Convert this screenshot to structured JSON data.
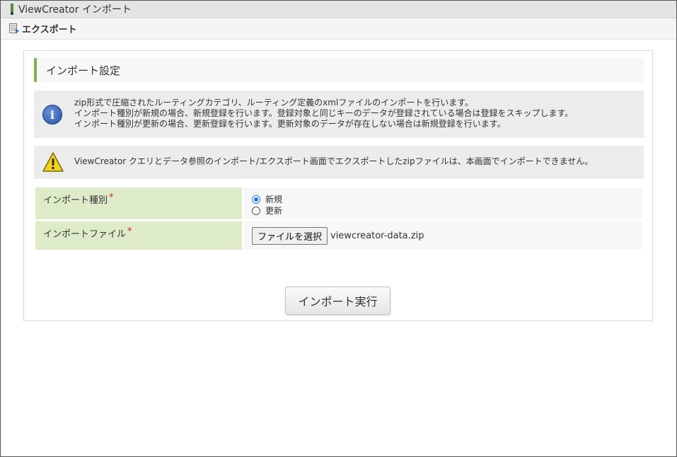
{
  "window": {
    "title": "ViewCreator インポート"
  },
  "toolbar": {
    "export_label": "エクスポート",
    "export_icon": "export-icon"
  },
  "section": {
    "title": "インポート設定"
  },
  "info_message": {
    "icon": "info-icon",
    "lines": [
      "zip形式で圧縮されたルーティングカテゴリ、ルーティング定義のxmlファイルのインポートを行います。",
      "インポート種別が新規の場合、新規登録を行います。登録対象と同じキーのデータが登録されている場合は登録をスキップします。",
      "インポート種別が更新の場合、更新登録を行います。更新対象のデータが存在しない場合は新規登録を行います。"
    ]
  },
  "warning_message": {
    "icon": "warning-icon",
    "text": "ViewCreator クエリとデータ参照のインポート/エクスポート画面でエクスポートしたzipファイルは、本画面でインポートできません。"
  },
  "form": {
    "import_type": {
      "label": "インポート種別",
      "required_mark": "*",
      "options": [
        {
          "label": "新規",
          "selected": true
        },
        {
          "label": "更新",
          "selected": false
        }
      ]
    },
    "import_file": {
      "label": "インポートファイル",
      "required_mark": "*",
      "button_label": "ファイルを選択",
      "file_name": "viewcreator-data.zip"
    }
  },
  "actions": {
    "submit_label": "インポート実行"
  },
  "colors": {
    "accent_green": "#7fb04a",
    "label_bg": "#deebc8",
    "required_red": "#d02020",
    "radio_blue": "#1a73e8"
  }
}
